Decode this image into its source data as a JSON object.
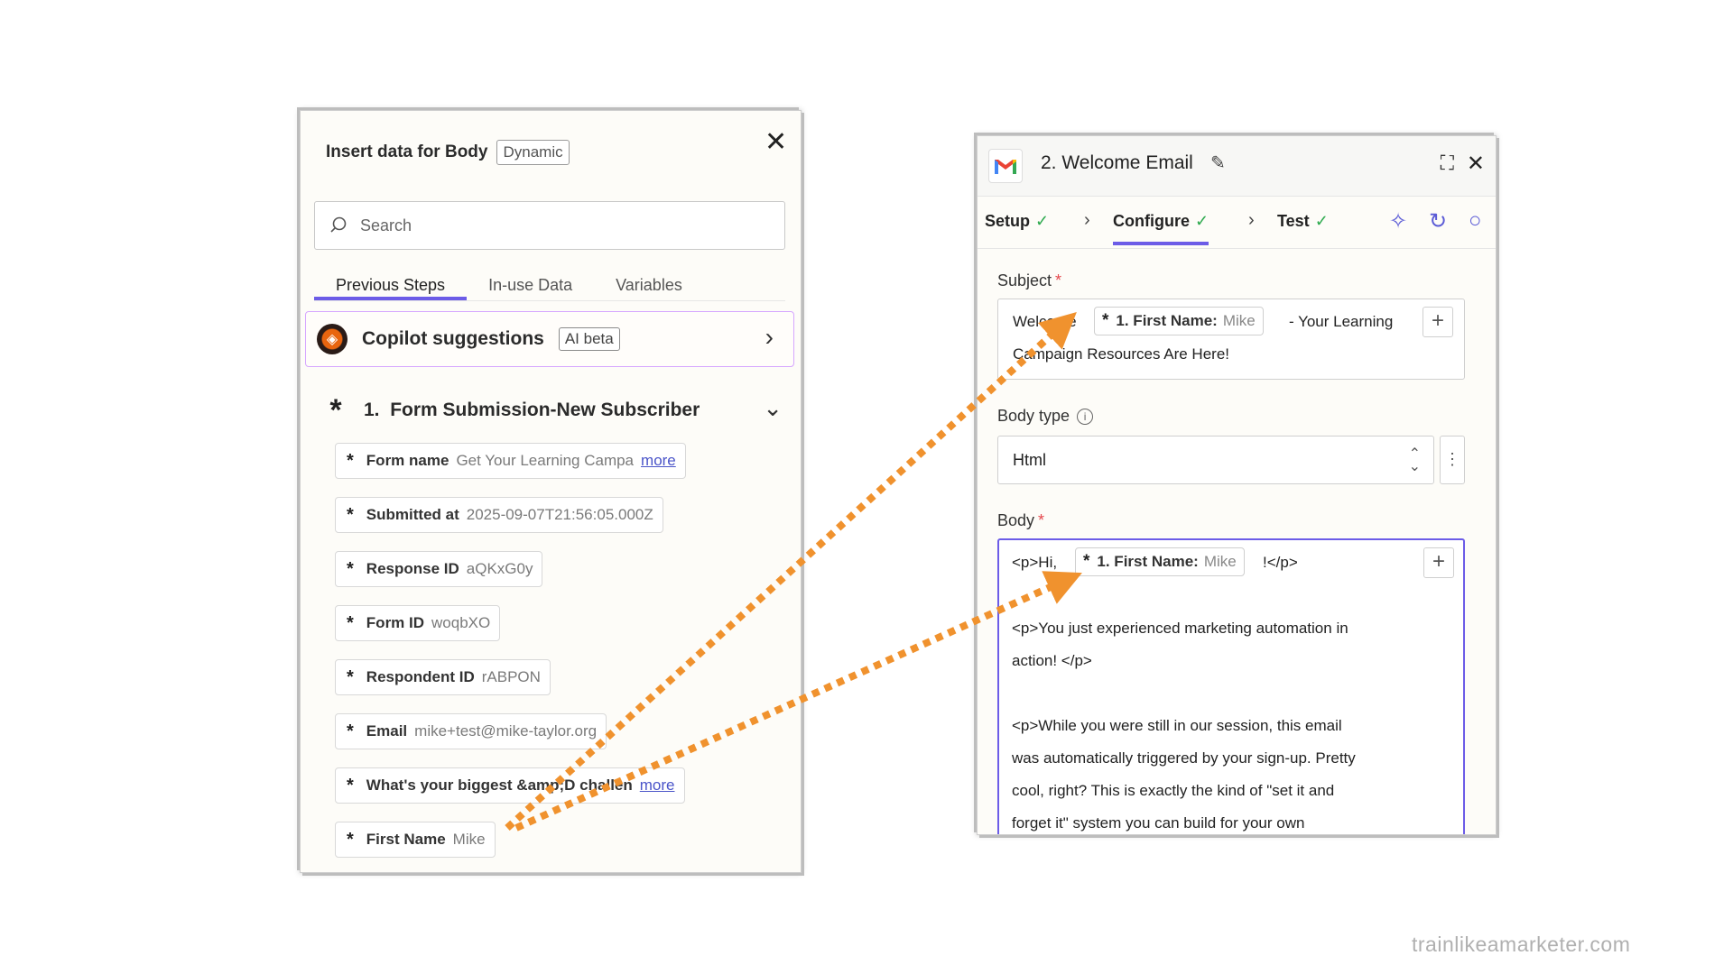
{
  "insert_panel": {
    "title": "Insert data for Body",
    "badge": "Dynamic",
    "search_placeholder": "Search",
    "tabs": [
      "Previous Steps",
      "In-use Data",
      "Variables"
    ],
    "copilot": {
      "label": "Copilot suggestions",
      "badge": "AI beta"
    },
    "step": {
      "number": "1.",
      "title": "Form Submission-New Subscriber"
    },
    "fields": [
      {
        "name": "Form name",
        "value": "Get Your Learning Campa",
        "more": "more"
      },
      {
        "name": "Submitted at",
        "value": "2025-09-07T21:56:05.000Z"
      },
      {
        "name": "Response ID",
        "value": "aQKxG0y"
      },
      {
        "name": "Form ID",
        "value": "woqbXO"
      },
      {
        "name": "Respondent ID",
        "value": "rABPON"
      },
      {
        "name": "Email",
        "value": "mike+test@mike-taylor.org"
      },
      {
        "name": "What's your biggest &amp;D challen",
        "value": "",
        "more": "more"
      },
      {
        "name": "First Name",
        "value": "Mike"
      }
    ]
  },
  "email_panel": {
    "title": "2. Welcome Email",
    "steps": [
      {
        "label": "Setup"
      },
      {
        "label": "Configure"
      },
      {
        "label": "Test"
      }
    ],
    "subject": {
      "label": "Subject",
      "required": "*",
      "before": "Welcome",
      "pill_name": "1. First Name:",
      "pill_value": "Mike",
      "after": "- Your Learning",
      "line2": "Campaign Resources Are Here!"
    },
    "body_type": {
      "label": "Body type",
      "value": "Html"
    },
    "body": {
      "label": "Body",
      "required": "*",
      "line1_before": "<p>Hi,",
      "pill_name": "1. First Name:",
      "pill_value": "Mike",
      "line1_after": "!</p>",
      "lines": [
        "<p>You just experienced marketing automation in",
        "action! </p>",
        "",
        "<p>While you were still in our session, this email",
        "was automatically triggered by your sign-up. Pretty",
        "cool, right? This is exactly the kind of \"set it and",
        "forget it\" system you can build for your own"
      ]
    }
  },
  "watermark": "trainlikeamarketer.com",
  "colors": {
    "accent": "#6c5ce7",
    "arrow": "#f0922e",
    "success": "#2eaa4f",
    "required": "#e5484d"
  }
}
